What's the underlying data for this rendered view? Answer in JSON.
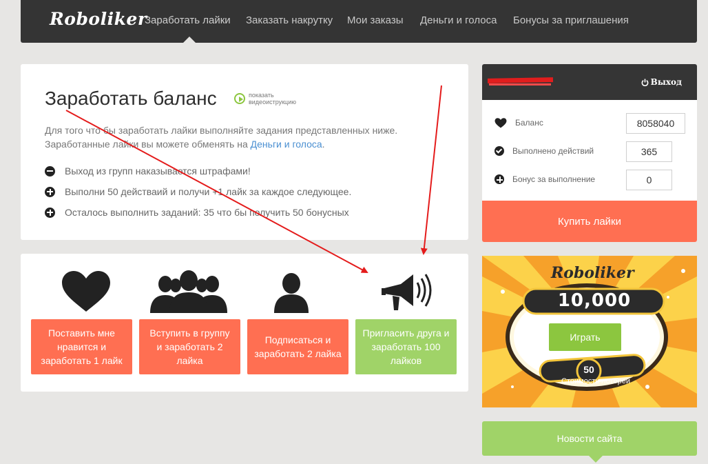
{
  "brand": {
    "logo": "Roboliker"
  },
  "nav": {
    "items": [
      {
        "label": "Заработать лайки"
      },
      {
        "label": "Заказать накрутку"
      },
      {
        "label": "Мои заказы"
      },
      {
        "label": "Деньги и голоса"
      },
      {
        "label": "Бонусы за приглашения"
      }
    ]
  },
  "info": {
    "title": "Заработать баланс",
    "video_link": "показать видеоиструкцию",
    "intro_text": "Для того что бы заработать лайки выполняйте задания представленных ниже. Заработанные лайки вы можете обменять на",
    "intro_link": "Деньги и голоса",
    "intro_end": ".",
    "rules": [
      {
        "icon": "minus-circle-icon",
        "text": "Выход из групп наказывается штрафами!"
      },
      {
        "icon": "plus-circle-icon",
        "text": "Выполни 50 действаий и получи +1 лайк за каждое следующее."
      },
      {
        "icon": "plus-circle-icon",
        "text": "Осталось выполнить заданий: 35 что бы получить 50 бонусных"
      }
    ]
  },
  "tasks": [
    {
      "icon": "heart-icon",
      "label": "Поставить мне нравится и заработать 1 лайк",
      "color": "#ff6f52"
    },
    {
      "icon": "group-icon",
      "label": "Вступить в группу и заработать 2 лайка",
      "color": "#ff6f52"
    },
    {
      "icon": "user-icon",
      "label": "Подписаться и заработать 2 лайка",
      "color": "#ff6f52"
    },
    {
      "icon": "megaphone-icon",
      "label": "Пригласить друга и заработать 100 лайков",
      "color": "#a0d368"
    }
  ],
  "account": {
    "logout": "Выход",
    "stats": [
      {
        "icon": "heart-icon",
        "label": "Баланс",
        "value": "8058040"
      },
      {
        "icon": "check-circle-icon",
        "label": "Выполнено действий",
        "value": "365"
      },
      {
        "icon": "plus-circle-icon",
        "label": "Бонус за выполнение",
        "value": "0"
      }
    ],
    "buy_label": "Купить лайки"
  },
  "lottery": {
    "brand": "Roboliker",
    "amount": "10,000",
    "play_label": "Играть",
    "cost": "50",
    "cost_label": "Стоимость лотереи"
  },
  "news": {
    "label": "Новости сайта"
  },
  "colors": {
    "accent_orange": "#ff6f52",
    "accent_green": "#a0d368",
    "dark": "#343434"
  }
}
